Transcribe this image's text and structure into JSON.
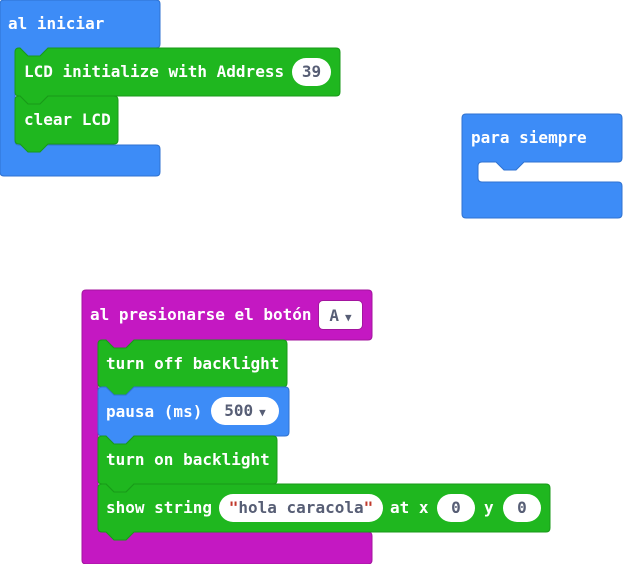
{
  "blocks": {
    "on_start": {
      "label": "al iniciar",
      "lcd_init_label": "LCD initialize with Address",
      "lcd_address": "39",
      "clear_label": "clear LCD"
    },
    "forever": {
      "label": "para siempre"
    },
    "on_button": {
      "label": "al presionarse el botón",
      "button_value": "A",
      "backlight_off_label": "turn off backlight",
      "pause_label": "pausa (ms)",
      "pause_value": "500",
      "backlight_on_label": "turn on backlight",
      "show_string_label": "show string",
      "string_value": "hola caracola",
      "at_x_label": "at x",
      "x_value": "0",
      "y_label": "y",
      "y_value": "0"
    }
  },
  "colors": {
    "basic_blue": "#3d8cf7",
    "lcd_green": "#1fb71f",
    "input_magenta": "#c418c2"
  },
  "icons": [
    "dropdown-arrow-icon"
  ]
}
